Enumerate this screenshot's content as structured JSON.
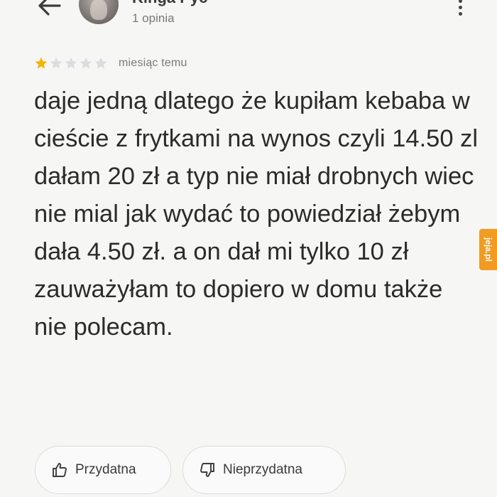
{
  "header": {
    "back_icon": "arrow-left-icon",
    "author_name": "Kinga Pyć",
    "review_count": "1 opinia",
    "more_icon": "more-vertical-icon"
  },
  "review": {
    "rating": 1,
    "max_rating": 5,
    "star_filled_color": "#f5b400",
    "star_empty_color": "#dadce0",
    "time": "miesiąc temu",
    "text": "daje jedną dlatego że kupiłam kebaba w cieście z frytkami na wynos czyli 14.50 zl dałam 20 zł a typ nie miał drobnych wiec nie mial jak wydać to powiedział żebym dała 4.50 zł. a on dał mi tylko 10 zł zauważyłam to dopiero w domu także nie polecam."
  },
  "actions": {
    "helpful_label": "Przydatna",
    "helpful_icon": "thumbs-up-icon",
    "unhelpful_label": "Nieprzydatna",
    "unhelpful_icon": "thumbs-down-icon"
  },
  "watermark": {
    "text": "jeja.pl",
    "color": "#f29b22"
  }
}
